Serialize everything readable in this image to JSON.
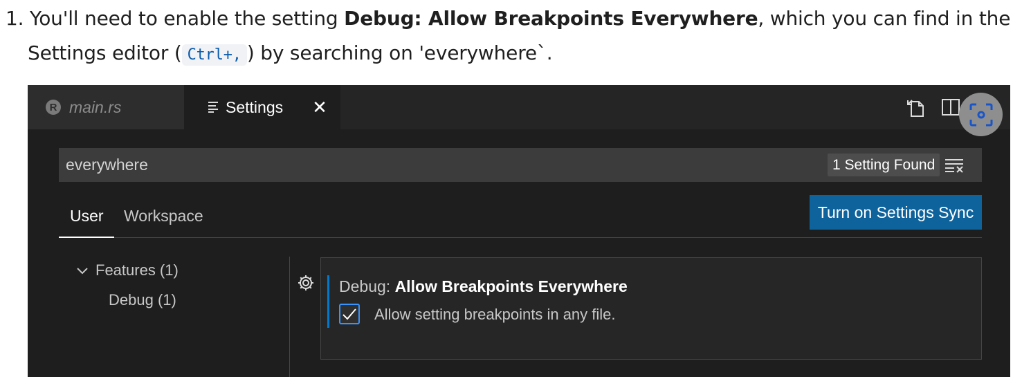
{
  "doc": {
    "list_number": "1.",
    "text_1": "You'll need to enable the setting ",
    "setting_bold": "Debug: Allow Breakpoints Everywhere",
    "text_2": ", which you can find in the",
    "text_3": "Settings editor (",
    "shortcut": "Ctrl+,",
    "text_4": ") by searching on 'everywhere`."
  },
  "editor": {
    "tabs": [
      {
        "label": "main.rs",
        "icon": "rust-icon",
        "active": false
      },
      {
        "label": "Settings",
        "icon": "settings-lines-icon",
        "active": true
      }
    ],
    "toolbar_icons": [
      "open-settings-json-icon",
      "split-editor-icon",
      "screenshot-capture-icon"
    ],
    "search": {
      "value": "everywhere",
      "result_count": "1 Setting Found",
      "clear_icon": "clear-filter-icon"
    },
    "scopes": [
      "User",
      "Workspace"
    ],
    "sync_button": "Turn on Settings Sync",
    "toc": [
      {
        "label": "Features (1)",
        "expanded": true
      },
      {
        "label": "Debug (1)"
      }
    ],
    "setting": {
      "category": "Debug: ",
      "name": "Allow Breakpoints Everywhere",
      "description": "Allow setting breakpoints in any file.",
      "checked": true
    }
  },
  "colors": {
    "accent": "#007acc",
    "sync_button": "#0e639c",
    "background": "#1e1e1e"
  }
}
